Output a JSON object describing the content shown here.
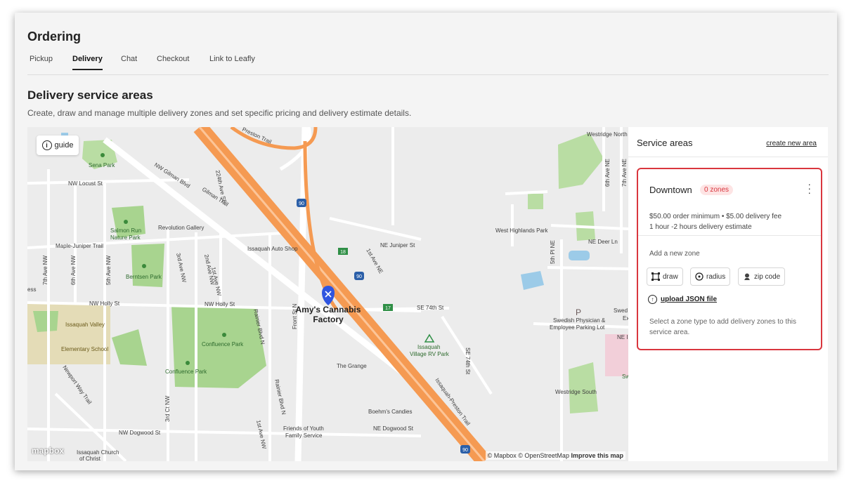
{
  "header": {
    "title": "Ordering"
  },
  "tabs": [
    {
      "label": "Pickup"
    },
    {
      "label": "Delivery",
      "active": true
    },
    {
      "label": "Chat"
    },
    {
      "label": "Checkout"
    },
    {
      "label": "Link to Leafly"
    }
  ],
  "section": {
    "title": "Delivery service areas",
    "description": "Create, draw and manage multiple delivery zones and set specific pricing and delivery estimate details."
  },
  "map": {
    "guide_label": "guide",
    "marker_label_line1": "Amy's Cannabis",
    "marker_label_line2": "Factory",
    "mapbox_logo": "mapbox",
    "attribution_text": "© Mapbox © OpenStreetMap",
    "improve_label": "Improve this map",
    "labels": {
      "sena_park": "Sena Park",
      "nw_locust": "NW Locust St",
      "nw_gilman": "NW Gilman Blvd",
      "gilman_trail": "Gilman Trail",
      "ave_224": "224th Ave SE",
      "preston_trail": "Preston Trail",
      "revolution_gallery": "Revolution Gallery",
      "salmon_run_1": "Salmon Run",
      "salmon_run_2": "Nature Park",
      "maple_juniper": "Maple-Juniper Trail",
      "issaquah_auto": "Issaquah Auto Shop",
      "ne_juniper": "NE Juniper St",
      "ave_1st_ne": "1st Ave NE",
      "berntsen": "Berntsen Park",
      "nw_holly_1": "NW Holly St",
      "nw_holly_2": "NW Holly St",
      "se_74th": "SE 74th St",
      "se_74th_v": "SE 74th St",
      "issaquah_valley_1": "Issaquah Valley",
      "issaquah_valley_2": "Elementary School",
      "confluence_1": "Confluence Park",
      "confluence_2": "Confluence Park",
      "the_grange": "The Grange",
      "village_rv_1": "Issaquah",
      "village_rv_2": "Village RV Park",
      "front_st": "Front St N",
      "rainier_1": "Rainier Blvd N",
      "rainier_2": "Rainier Blvd N",
      "newport_trail": "Newport Way Trail",
      "nw_dogwood": "NW Dogwood St",
      "ne_dogwood": "NE Dogwood St",
      "friends_1": "Friends of Youth",
      "friends_2": "Family Service",
      "boehms": "Boehm's Candies",
      "issaquah_preston": "Issaquah-Preston Trail",
      "church_1": "Issaquah Church",
      "church_2": "of Christ",
      "west_highlands": "West Highlands Park",
      "ne_deer": "NE Deer Ln",
      "ave_5th_pl": "5th Pl NE",
      "swedish_1": "Swedish Physician &",
      "swedish_2": "Employee Parking Lot",
      "westridge_south": "Westridge South",
      "westridge_north": "Westridge North",
      "ave_6th_ne": "6th Ave NE",
      "ave_7th_ne": "7th Ave NE",
      "ave_7th_nw": "7th Ave NW",
      "ave_6th_nw": "6th Ave NW",
      "ave_5th_nw": "5th Ave NW",
      "ave_3rd_nw": "3rd Ave NW",
      "ave_2nd_nw": "2nd Ave NW",
      "ave_1st_nw": "1st Ave NW",
      "ct_3rd_nw": "3rd Ct NW",
      "ave_1st_nw_s": "1st Ave NW",
      "i90_1": "90",
      "i90_2": "90",
      "i90_3": "90",
      "r18": "18",
      "r17": "17",
      "ne_cut": "NE I",
      "swed_cut": "Swed",
      "ex_cut": "Ex",
      "ess_cut": "ess",
      "sw_cut": "Sw",
      "p_sym": "P"
    }
  },
  "panel": {
    "title": "Service areas",
    "create_link": "create new area",
    "zone": {
      "name": "Downtown",
      "badge": "0 zones",
      "info_line1": "$50.00 order minimum • $5.00 delivery fee",
      "info_line2": "1 hour -2 hours delivery estimate",
      "add_zone_label": "Add a new zone",
      "buttons": {
        "draw": "draw",
        "radius": "radius",
        "zip": "zip code"
      },
      "upload_label": "upload JSON file",
      "hint": "Select a zone type to add delivery zones to this service area."
    }
  }
}
